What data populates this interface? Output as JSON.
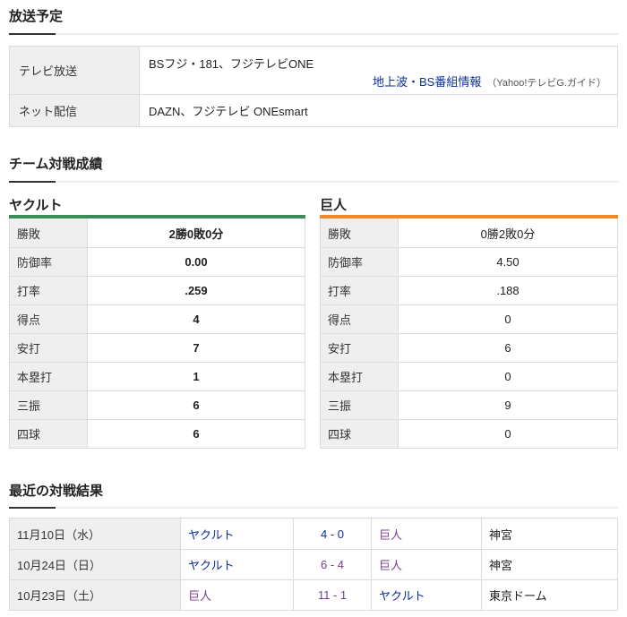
{
  "broadcast": {
    "title": "放送予定",
    "tv_label": "テレビ放送",
    "tv_value": "BSフジ・181、フジテレビONE",
    "guide_link": "地上波・BS番組情報",
    "guide_note": "（Yahoo!テレビG.ガイド）",
    "net_label": "ネット配信",
    "net_value": "DAZN、フジテレビ ONEsmart"
  },
  "matchup": {
    "title": "チーム対戦成績",
    "home": {
      "name": "ヤクルト",
      "color": "#3c8c5a",
      "stats": [
        {
          "label": "勝敗",
          "value": "2勝0敗0分"
        },
        {
          "label": "防御率",
          "value": "0.00"
        },
        {
          "label": "打率",
          "value": ".259"
        },
        {
          "label": "得点",
          "value": "4"
        },
        {
          "label": "安打",
          "value": "7"
        },
        {
          "label": "本塁打",
          "value": "1"
        },
        {
          "label": "三振",
          "value": "6"
        },
        {
          "label": "四球",
          "value": "6"
        }
      ]
    },
    "away": {
      "name": "巨人",
      "color": "#ed8a2f",
      "stats": [
        {
          "label": "勝敗",
          "value": "0勝2敗0分"
        },
        {
          "label": "防御率",
          "value": "4.50"
        },
        {
          "label": "打率",
          "value": ".188"
        },
        {
          "label": "得点",
          "value": "0"
        },
        {
          "label": "安打",
          "value": "6"
        },
        {
          "label": "本塁打",
          "value": "0"
        },
        {
          "label": "三振",
          "value": "9"
        },
        {
          "label": "四球",
          "value": "0"
        }
      ]
    }
  },
  "recent": {
    "title": "最近の対戦結果",
    "rows": [
      {
        "date": "11月10日（水）",
        "team1": "ヤクルト",
        "team1_color": "#0b2f9e",
        "score": "4 - 0",
        "score_color": "#0b2f9e",
        "team2": "巨人",
        "team2_color": "#7a3c8f",
        "venue": "神宮"
      },
      {
        "date": "10月24日（日）",
        "team1": "ヤクルト",
        "team1_color": "#0b2f9e",
        "score": "6 - 4",
        "score_color": "#7a3c8f",
        "team2": "巨人",
        "team2_color": "#7a3c8f",
        "venue": "神宮"
      },
      {
        "date": "10月23日（土）",
        "team1": "巨人",
        "team1_color": "#7a3c8f",
        "score": "11 - 1",
        "score_color": "#7a3c8f",
        "team2": "ヤクルト",
        "team2_color": "#0b2f9e",
        "venue": "東京ドーム"
      }
    ]
  }
}
